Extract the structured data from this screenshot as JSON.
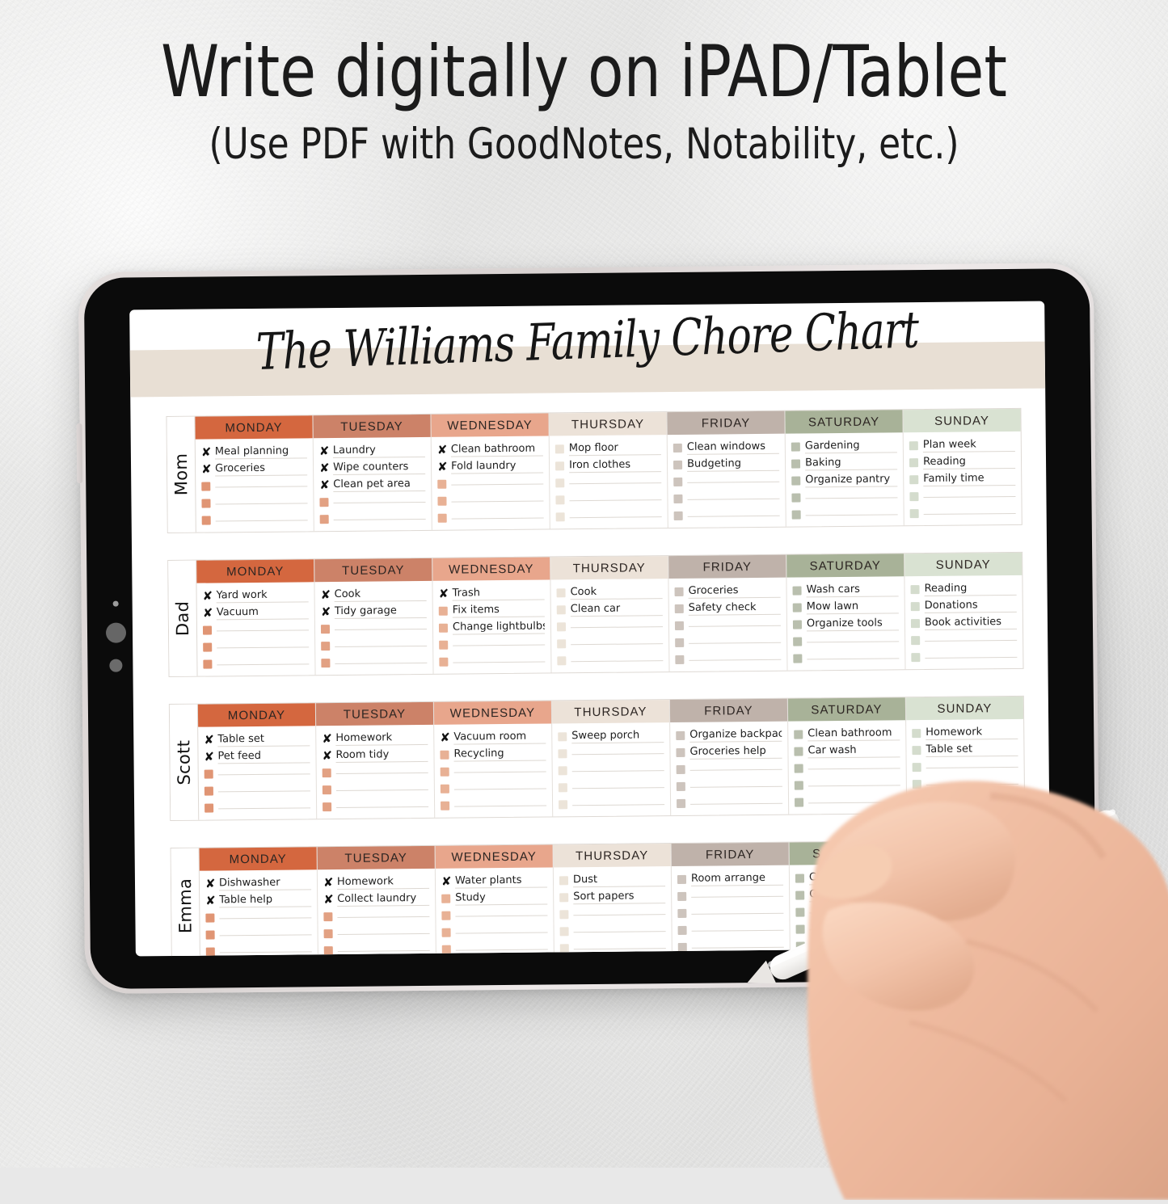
{
  "promo": {
    "headline": "Write digitally on iPAD/Tablet",
    "subheadline": "(Use PDF with GoodNotes, Notability, etc.)"
  },
  "chart": {
    "title": "The Williams Family Chore Chart",
    "banner_color": "#e8dfd4",
    "days": [
      "MONDAY",
      "TUESDAY",
      "WEDNESDAY",
      "THURSDAY",
      "FRIDAY",
      "SATURDAY",
      "SUNDAY"
    ],
    "day_header_colors": [
      "#d4673f",
      "#cc8268",
      "#e8a68c",
      "#ece2d8",
      "#bfb2aa",
      "#a8b298",
      "#d9e2d2"
    ],
    "day_box_colors": [
      "#e09574",
      "#e2a183",
      "#e8b195",
      "#ece4d9",
      "#cdc4bd",
      "#b9bfae",
      "#d4dccd"
    ],
    "rows_per_day": 5,
    "people": [
      {
        "name": "Mom",
        "days": [
          {
            "day": "MONDAY",
            "tasks": [
              {
                "text": "Meal planning",
                "checked": true
              },
              {
                "text": "Groceries",
                "checked": true
              },
              {
                "text": "",
                "checked": false
              },
              {
                "text": "",
                "checked": false
              },
              {
                "text": "",
                "checked": false
              }
            ]
          },
          {
            "day": "TUESDAY",
            "tasks": [
              {
                "text": "Laundry",
                "checked": true
              },
              {
                "text": "Wipe counters",
                "checked": true
              },
              {
                "text": "Clean pet area",
                "checked": true
              },
              {
                "text": "",
                "checked": false
              },
              {
                "text": "",
                "checked": false
              }
            ]
          },
          {
            "day": "WEDNESDAY",
            "tasks": [
              {
                "text": "Clean bathroom",
                "checked": true
              },
              {
                "text": "Fold laundry",
                "checked": true
              },
              {
                "text": "",
                "checked": false
              },
              {
                "text": "",
                "checked": false
              },
              {
                "text": "",
                "checked": false
              }
            ]
          },
          {
            "day": "THURSDAY",
            "tasks": [
              {
                "text": "Mop floor",
                "checked": false
              },
              {
                "text": "Iron clothes",
                "checked": false
              },
              {
                "text": "",
                "checked": false
              },
              {
                "text": "",
                "checked": false
              },
              {
                "text": "",
                "checked": false
              }
            ]
          },
          {
            "day": "FRIDAY",
            "tasks": [
              {
                "text": "Clean windows",
                "checked": false
              },
              {
                "text": "Budgeting",
                "checked": false
              },
              {
                "text": "",
                "checked": false
              },
              {
                "text": "",
                "checked": false
              },
              {
                "text": "",
                "checked": false
              }
            ]
          },
          {
            "day": "SATURDAY",
            "tasks": [
              {
                "text": "Gardening",
                "checked": false
              },
              {
                "text": "Baking",
                "checked": false
              },
              {
                "text": "Organize pantry",
                "checked": false
              },
              {
                "text": "",
                "checked": false
              },
              {
                "text": "",
                "checked": false
              }
            ]
          },
          {
            "day": "SUNDAY",
            "tasks": [
              {
                "text": "Plan week",
                "checked": false
              },
              {
                "text": "Reading",
                "checked": false
              },
              {
                "text": "Family time",
                "checked": false
              },
              {
                "text": "",
                "checked": false
              },
              {
                "text": "",
                "checked": false
              }
            ]
          }
        ]
      },
      {
        "name": "Dad",
        "days": [
          {
            "day": "MONDAY",
            "tasks": [
              {
                "text": "Yard work",
                "checked": true
              },
              {
                "text": "Vacuum",
                "checked": true
              },
              {
                "text": "",
                "checked": false
              },
              {
                "text": "",
                "checked": false
              },
              {
                "text": "",
                "checked": false
              }
            ]
          },
          {
            "day": "TUESDAY",
            "tasks": [
              {
                "text": "Cook",
                "checked": true
              },
              {
                "text": "Tidy garage",
                "checked": true
              },
              {
                "text": "",
                "checked": false
              },
              {
                "text": "",
                "checked": false
              },
              {
                "text": "",
                "checked": false
              }
            ]
          },
          {
            "day": "WEDNESDAY",
            "tasks": [
              {
                "text": "Trash",
                "checked": true
              },
              {
                "text": "Fix items",
                "checked": false
              },
              {
                "text": "Change lightbulbs",
                "checked": false
              },
              {
                "text": "",
                "checked": false
              },
              {
                "text": "",
                "checked": false
              }
            ]
          },
          {
            "day": "THURSDAY",
            "tasks": [
              {
                "text": "Cook",
                "checked": false
              },
              {
                "text": "Clean car",
                "checked": false
              },
              {
                "text": "",
                "checked": false
              },
              {
                "text": "",
                "checked": false
              },
              {
                "text": "",
                "checked": false
              }
            ]
          },
          {
            "day": "FRIDAY",
            "tasks": [
              {
                "text": "Groceries",
                "checked": false
              },
              {
                "text": "Safety check",
                "checked": false
              },
              {
                "text": "",
                "checked": false
              },
              {
                "text": "",
                "checked": false
              },
              {
                "text": "",
                "checked": false
              }
            ]
          },
          {
            "day": "SATURDAY",
            "tasks": [
              {
                "text": "Wash cars",
                "checked": false
              },
              {
                "text": "Mow lawn",
                "checked": false
              },
              {
                "text": "Organize tools",
                "checked": false
              },
              {
                "text": "",
                "checked": false
              },
              {
                "text": "",
                "checked": false
              }
            ]
          },
          {
            "day": "SUNDAY",
            "tasks": [
              {
                "text": "Reading",
                "checked": false
              },
              {
                "text": "Donations",
                "checked": false
              },
              {
                "text": "Book activities",
                "checked": false
              },
              {
                "text": "",
                "checked": false
              },
              {
                "text": "",
                "checked": false
              }
            ]
          }
        ]
      },
      {
        "name": "Scott",
        "days": [
          {
            "day": "MONDAY",
            "tasks": [
              {
                "text": "Table set",
                "checked": true
              },
              {
                "text": "Pet feed",
                "checked": true
              },
              {
                "text": "",
                "checked": false
              },
              {
                "text": "",
                "checked": false
              },
              {
                "text": "",
                "checked": false
              }
            ]
          },
          {
            "day": "TUESDAY",
            "tasks": [
              {
                "text": "Homework",
                "checked": true
              },
              {
                "text": "Room tidy",
                "checked": true
              },
              {
                "text": "",
                "checked": false
              },
              {
                "text": "",
                "checked": false
              },
              {
                "text": "",
                "checked": false
              }
            ]
          },
          {
            "day": "WEDNESDAY",
            "tasks": [
              {
                "text": "Vacuum room",
                "checked": true
              },
              {
                "text": "Recycling",
                "checked": false
              },
              {
                "text": "",
                "checked": false
              },
              {
                "text": "",
                "checked": false
              },
              {
                "text": "",
                "checked": false
              }
            ]
          },
          {
            "day": "THURSDAY",
            "tasks": [
              {
                "text": "Sweep porch",
                "checked": false
              },
              {
                "text": "",
                "checked": false
              },
              {
                "text": "",
                "checked": false
              },
              {
                "text": "",
                "checked": false
              },
              {
                "text": "",
                "checked": false
              }
            ]
          },
          {
            "day": "FRIDAY",
            "tasks": [
              {
                "text": "Organize backpack",
                "checked": false
              },
              {
                "text": "Groceries help",
                "checked": false
              },
              {
                "text": "",
                "checked": false
              },
              {
                "text": "",
                "checked": false
              },
              {
                "text": "",
                "checked": false
              }
            ]
          },
          {
            "day": "SATURDAY",
            "tasks": [
              {
                "text": "Clean bathroom",
                "checked": false
              },
              {
                "text": "Car wash",
                "checked": false
              },
              {
                "text": "",
                "checked": false
              },
              {
                "text": "",
                "checked": false
              },
              {
                "text": "",
                "checked": false
              }
            ]
          },
          {
            "day": "SUNDAY",
            "tasks": [
              {
                "text": "Homework",
                "checked": false
              },
              {
                "text": "Table set",
                "checked": false
              },
              {
                "text": "",
                "checked": false
              },
              {
                "text": "",
                "checked": false
              },
              {
                "text": "",
                "checked": false
              }
            ]
          }
        ]
      },
      {
        "name": "Emma",
        "days": [
          {
            "day": "MONDAY",
            "tasks": [
              {
                "text": "Dishwasher",
                "checked": true
              },
              {
                "text": "Table help",
                "checked": true
              },
              {
                "text": "",
                "checked": false
              },
              {
                "text": "",
                "checked": false
              },
              {
                "text": "",
                "checked": false
              }
            ]
          },
          {
            "day": "TUESDAY",
            "tasks": [
              {
                "text": "Homework",
                "checked": true
              },
              {
                "text": "Collect laundry",
                "checked": true
              },
              {
                "text": "",
                "checked": false
              },
              {
                "text": "",
                "checked": false
              },
              {
                "text": "",
                "checked": false
              }
            ]
          },
          {
            "day": "WEDNESDAY",
            "tasks": [
              {
                "text": "Water plants",
                "checked": true
              },
              {
                "text": "Study",
                "checked": false
              },
              {
                "text": "",
                "checked": false
              },
              {
                "text": "",
                "checked": false
              },
              {
                "text": "",
                "checked": false
              }
            ]
          },
          {
            "day": "THURSDAY",
            "tasks": [
              {
                "text": "Dust",
                "checked": false
              },
              {
                "text": "Sort papers",
                "checked": false
              },
              {
                "text": "",
                "checked": false
              },
              {
                "text": "",
                "checked": false
              },
              {
                "text": "",
                "checked": false
              }
            ]
          },
          {
            "day": "FRIDAY",
            "tasks": [
              {
                "text": "Room arrange",
                "checked": false
              },
              {
                "text": "",
                "checked": false
              },
              {
                "text": "",
                "checked": false
              },
              {
                "text": "",
                "checked": false
              },
              {
                "text": "",
                "checked": false
              }
            ]
          },
          {
            "day": "SATURDAY",
            "tasks": [
              {
                "text": "Clean appliances",
                "checked": false
              },
              {
                "text": "Gardening",
                "checked": false
              },
              {
                "text": "",
                "checked": false
              },
              {
                "text": "",
                "checked": false
              },
              {
                "text": "",
                "checked": false
              }
            ]
          },
          {
            "day": "SUNDAY",
            "tasks": [
              {
                "text": "",
                "checked": false
              },
              {
                "text": "",
                "checked": false
              },
              {
                "text": "",
                "checked": false
              },
              {
                "text": "",
                "checked": false
              },
              {
                "text": "",
                "checked": false
              }
            ]
          }
        ]
      }
    ]
  },
  "device": {
    "type": "tablet",
    "stylus": "white-stylus",
    "hand": "right-hand-writing"
  },
  "check_glyph": "✘"
}
